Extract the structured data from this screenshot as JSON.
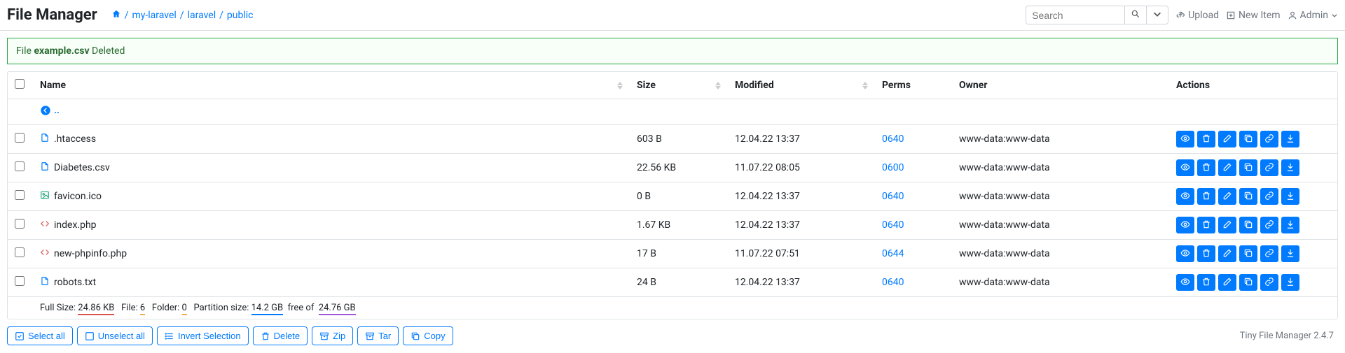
{
  "brand": "File Manager",
  "breadcrumb": [
    "my-laravel",
    "laravel",
    "public"
  ],
  "nav": {
    "search_placeholder": "Search",
    "upload": "Upload",
    "new_item": "New Item",
    "admin": "Admin"
  },
  "alert": {
    "prefix": "File",
    "filename": "example.csv",
    "suffix": "Deleted"
  },
  "columns": {
    "name": "Name",
    "size": "Size",
    "modified": "Modified",
    "perms": "Perms",
    "owner": "Owner",
    "actions": "Actions"
  },
  "back_label": "..",
  "files": [
    {
      "icon": "file",
      "name": ".htaccess",
      "size": "603 B",
      "modified": "12.04.22 13:37",
      "perms": "0640",
      "owner": "www-data:www-data"
    },
    {
      "icon": "file",
      "name": "Diabetes.csv",
      "size": "22.56 KB",
      "modified": "11.07.22 08:05",
      "perms": "0600",
      "owner": "www-data:www-data"
    },
    {
      "icon": "image",
      "name": "favicon.ico",
      "size": "0 B",
      "modified": "12.04.22 13:37",
      "perms": "0640",
      "owner": "www-data:www-data"
    },
    {
      "icon": "code",
      "name": "index.php",
      "size": "1.67 KB",
      "modified": "12.04.22 13:37",
      "perms": "0640",
      "owner": "www-data:www-data"
    },
    {
      "icon": "code",
      "name": "new-phpinfo.php",
      "size": "17 B",
      "modified": "11.07.22 07:51",
      "perms": "0644",
      "owner": "www-data:www-data"
    },
    {
      "icon": "file",
      "name": "robots.txt",
      "size": "24 B",
      "modified": "12.04.22 13:37",
      "perms": "0640",
      "owner": "www-data:www-data"
    }
  ],
  "summary": {
    "fullsize_label": "Full Size:",
    "fullsize": "24.86 KB",
    "file_label": "File:",
    "file_count": "6",
    "folder_label": "Folder:",
    "folder_count": "0",
    "partition_label": "Partition size:",
    "partition_used": "14.2 GB",
    "free_of": "free of",
    "partition_total": "24.76 GB"
  },
  "toolbar": {
    "select_all": "Select all",
    "unselect_all": "Unselect all",
    "invert": "Invert Selection",
    "delete": "Delete",
    "zip": "Zip",
    "tar": "Tar",
    "copy": "Copy"
  },
  "footer": "Tiny File Manager 2.4.7"
}
